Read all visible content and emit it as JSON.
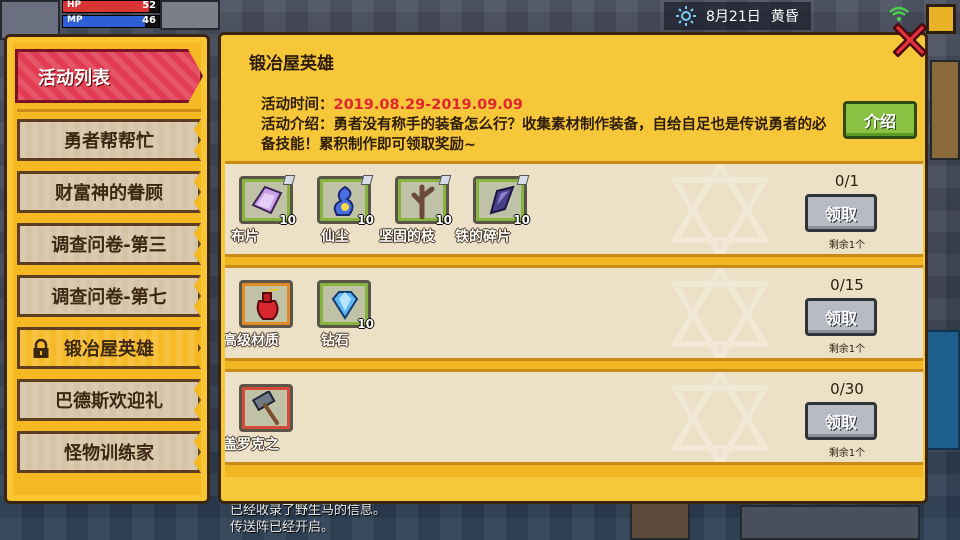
{
  "hud": {
    "hp_label": "HP",
    "hp_value": "52",
    "hp_fraction": 0.9,
    "mp_label": "MP",
    "mp_value": "46",
    "mp_fraction": 0.85,
    "date": "8月21日",
    "time_of_day": "黄昏"
  },
  "sidebar": {
    "header": "活动列表",
    "tabs": [
      {
        "label": "勇者帮帮忙",
        "active": false
      },
      {
        "label": "财富神的眷顾",
        "active": false
      },
      {
        "label": "调查问卷-第三",
        "active": false
      },
      {
        "label": "调查问卷-第七",
        "active": false
      },
      {
        "label": "锻冶屋英雄",
        "active": true,
        "locked": true
      },
      {
        "label": "巴德斯欢迎礼",
        "active": false
      },
      {
        "label": "怪物训练家",
        "active": false
      }
    ]
  },
  "panel": {
    "title": "锻冶屋英雄",
    "time_label": "活动时间：",
    "time_value": "2019.08.29-2019.09.09",
    "intro_label": "活动介绍：",
    "intro_text": "勇者没有称手的装备怎么行？收集素材制作装备，自给自足也是传说勇者的必备技能！累积制作即可领取奖励~",
    "intro_button": "介绍",
    "rows": [
      {
        "progress": "0/1",
        "claim": "领取",
        "remain": "剩余1个",
        "items": [
          {
            "name": "布片",
            "qty": "10",
            "icon": "cloth-icon"
          },
          {
            "name": "仙尘",
            "qty": "10",
            "icon": "fairy-dust-icon"
          },
          {
            "name": "坚固的枝",
            "qty": "10",
            "icon": "sturdy-branch-icon"
          },
          {
            "name": "铁的碎片",
            "qty": "10",
            "icon": "iron-shard-icon"
          }
        ]
      },
      {
        "progress": "0/15",
        "claim": "领取",
        "remain": "剩余1个",
        "items": [
          {
            "name": "高级材质",
            "qty": "",
            "icon": "premium-material-icon"
          },
          {
            "name": "钻石",
            "qty": "10",
            "icon": "diamond-icon"
          }
        ]
      },
      {
        "progress": "0/30",
        "claim": "领取",
        "remain": "剩余1个",
        "items": [
          {
            "name": "盖罗克之",
            "qty": "",
            "icon": "hammer-icon"
          }
        ]
      }
    ]
  },
  "log": {
    "line1": "已经收录了野生马的信息。",
    "line2": "传送阵已经开启。"
  },
  "colors": {
    "panel_yellow": "#f7c73a",
    "header_red": "#e23c52",
    "date_red": "#e0262e",
    "intro_green": "#89c242",
    "claim_gray": "#b7bcc4"
  }
}
